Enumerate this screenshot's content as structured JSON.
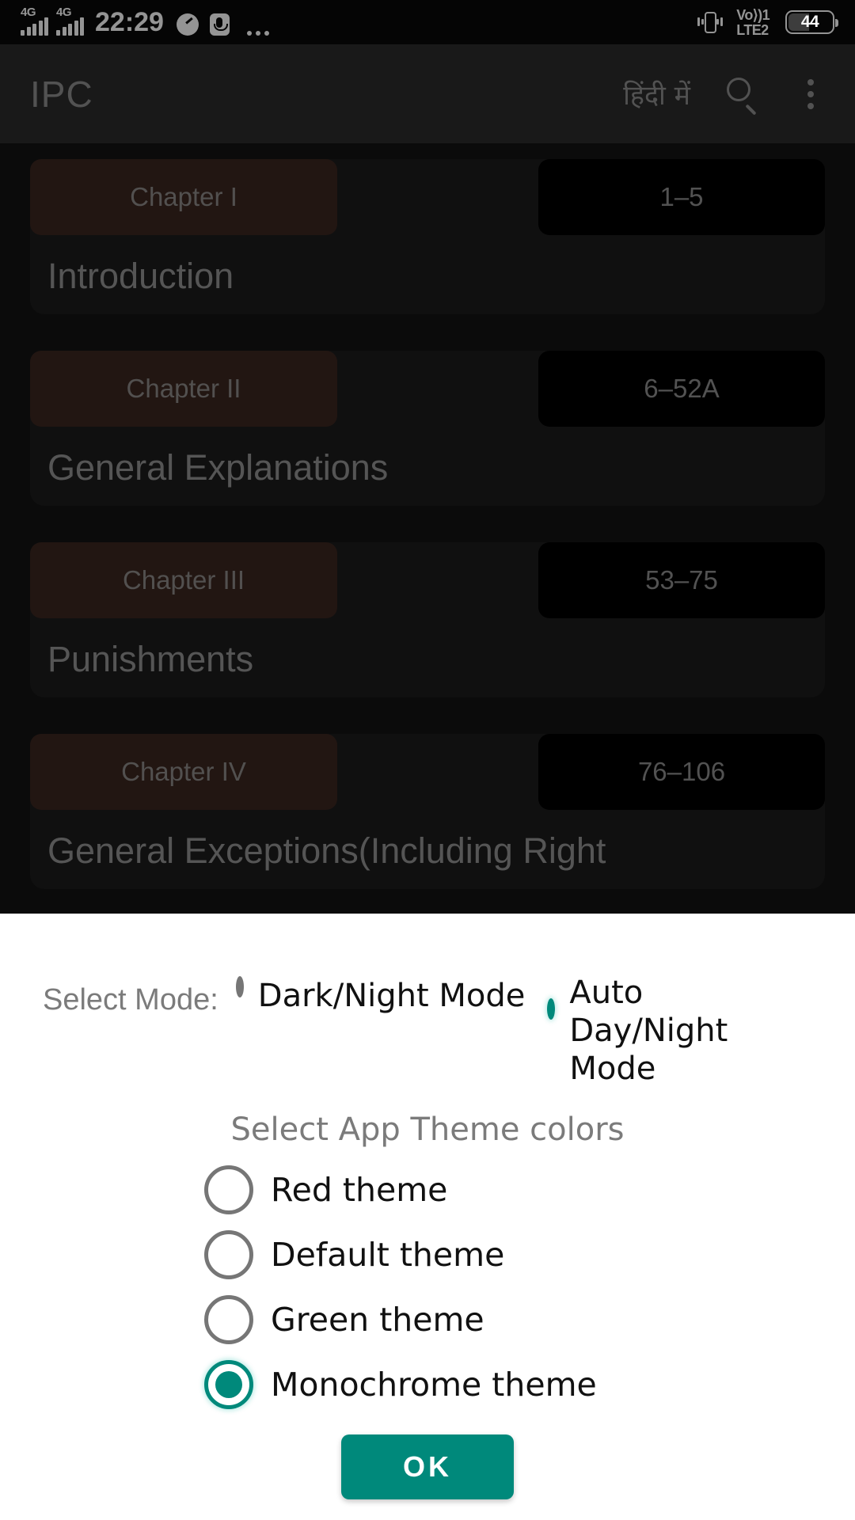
{
  "status_bar": {
    "network_label_1": "4G",
    "network_label_2": "4G",
    "time": "22:29",
    "speed_icon": "speedometer-icon",
    "mic_icon": "microphone-icon",
    "more_icon": "more-dots-icon",
    "vibrate_icon": "vibrate-icon",
    "volte_top": "Vo⟩)1",
    "volte_bottom": "LTE2",
    "battery_percent": "44"
  },
  "app_bar": {
    "title": "IPC",
    "language_label": "हिंदी में",
    "search_icon": "search-icon",
    "overflow_icon": "overflow-menu-icon"
  },
  "chapters": [
    {
      "chapter": "Chapter I",
      "range": "1–5",
      "title": "Introduction"
    },
    {
      "chapter": "Chapter II",
      "range": "6–52A",
      "title": "General Explanations"
    },
    {
      "chapter": "Chapter III",
      "range": "53–75",
      "title": "Punishments"
    },
    {
      "chapter": "Chapter IV",
      "range": "76–106",
      "title": "General Exceptions(Including Right"
    }
  ],
  "dialog": {
    "mode_label": "Select Mode:",
    "mode_options": [
      {
        "label": "Dark/Night Mode",
        "selected": false
      },
      {
        "label": "Auto Day/Night Mode",
        "selected": true
      }
    ],
    "theme_heading": "Select App Theme colors",
    "theme_options": [
      {
        "label": "Red theme",
        "selected": false
      },
      {
        "label": "Default theme",
        "selected": false
      },
      {
        "label": "Green theme",
        "selected": false
      },
      {
        "label": "Monochrome theme",
        "selected": true
      }
    ],
    "ok_label": "OK"
  },
  "colors": {
    "accent_teal": "#00897b",
    "app_bar_bg": "#2b2b2b",
    "card_bg": "#1c1c1c",
    "chapter_pill_bg": "#3b2620",
    "range_pill_bg": "#000000",
    "dialog_bg": "#ffffff"
  }
}
